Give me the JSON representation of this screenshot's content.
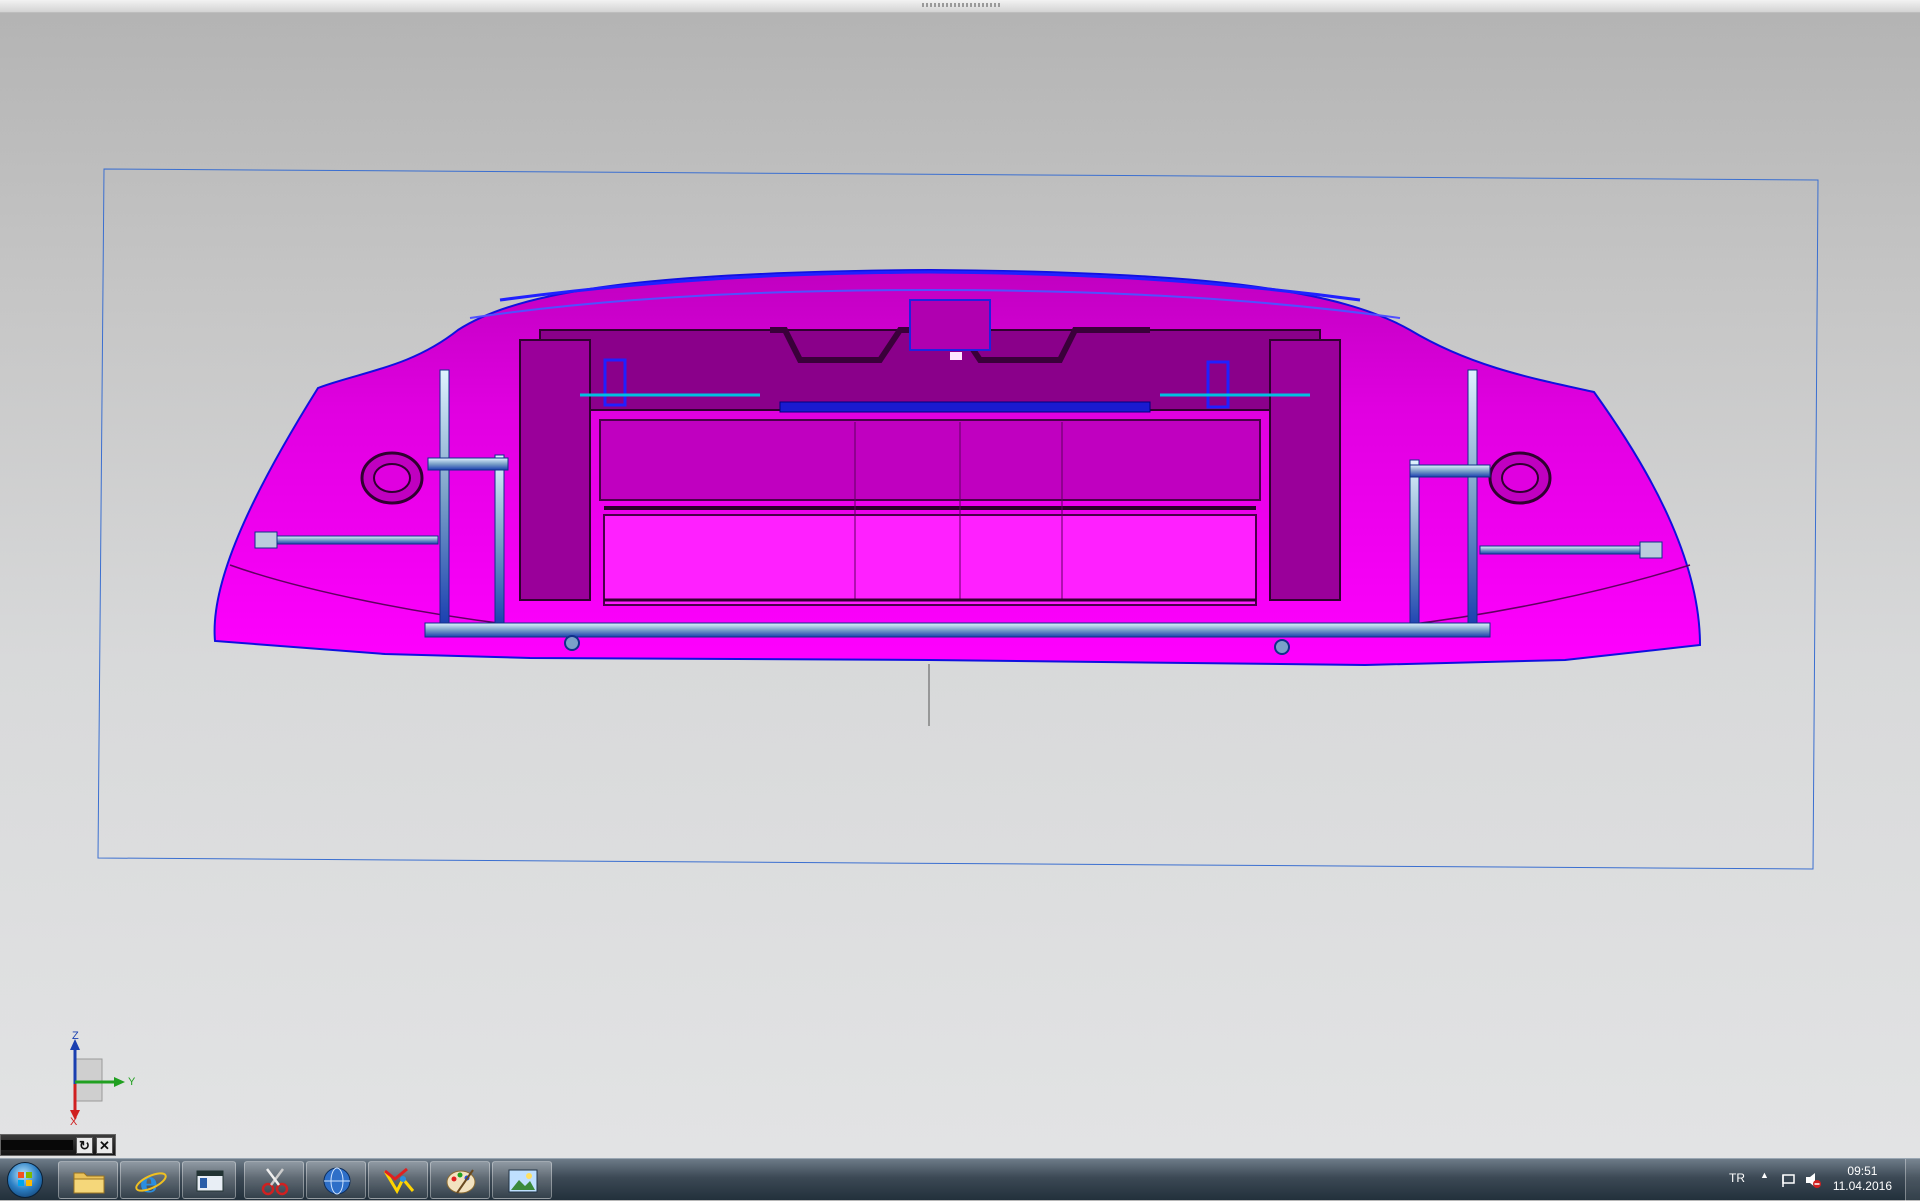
{
  "viewport": {
    "triad": {
      "z_label": "Z",
      "y_label": "Y",
      "x_label": "X"
    }
  },
  "taskbar": {
    "apps": [
      {
        "name": "Windows Explorer",
        "icon": "folder-icon"
      },
      {
        "name": "Internet Explorer",
        "icon": "ie-icon"
      },
      {
        "name": "Window",
        "icon": "window-icon"
      },
      {
        "name": "Snipping Tool",
        "icon": "scissors-icon"
      },
      {
        "name": "Browser",
        "icon": "globe-icon"
      },
      {
        "name": "CAD Application",
        "icon": "cad-icon"
      },
      {
        "name": "Paint",
        "icon": "palette-icon"
      },
      {
        "name": "Picture Viewer",
        "icon": "picture-icon"
      }
    ],
    "tray": {
      "language": "TR"
    },
    "clock": {
      "time": "09:51",
      "date": "11.04.2016"
    }
  },
  "colors": {
    "model_fill": "#ff00ff",
    "model_shade": "#a000a0",
    "edge_blue": "#1010e0",
    "frame_blue": "#3b6fd0"
  }
}
